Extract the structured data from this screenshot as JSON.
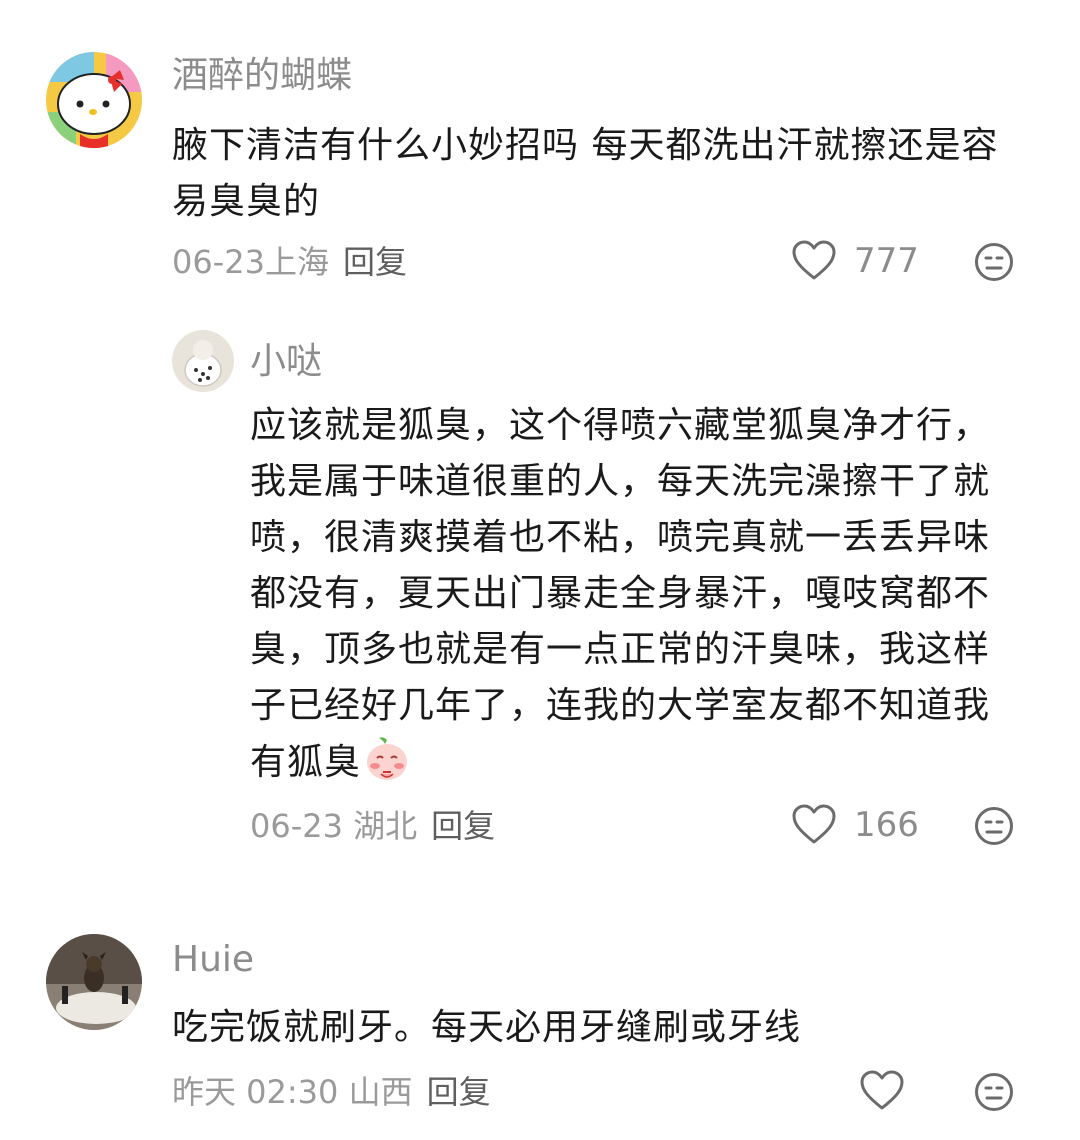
{
  "comments": [
    {
      "username": "酒醉的蝴蝶",
      "text": "腋下清洁有什么小妙招吗 每天都洗出汗就擦还是容易臭臭的",
      "date": "06-23",
      "location": "上海",
      "reply_label": "回复",
      "likes": "777"
    },
    {
      "username": "小哒",
      "text": "应该就是狐臭，这个得喷六藏堂狐臭净才行，我是属于味道很重的人，每天洗完澡擦干了就喷，很清爽摸着也不粘，喷完真就一丢丢异味都没有，夏天出门暴走全身暴汗，嘎吱窝都不臭，顶多也就是有一点正常的汗臭味，我这样子已经好几年了，连我的大学室友都不知道我有狐臭",
      "date": "06-23",
      "location": "湖北",
      "reply_label": "回复",
      "likes": "166"
    },
    {
      "username": "Huie",
      "text": "吃完饭就刷牙。每天必用牙缝刷或牙线",
      "date": "昨天 02:30",
      "location": "山西",
      "reply_label": "回复",
      "likes": ""
    }
  ],
  "icons": {
    "like": "heart-outline-icon",
    "dislike": "unhappy-face-icon",
    "emoji": "shy-peach-emoji"
  },
  "colors": {
    "username": "#8c8c8c",
    "text": "#1a1a1a",
    "meta": "#9a9a9a",
    "icon": "#6b6b6b"
  }
}
